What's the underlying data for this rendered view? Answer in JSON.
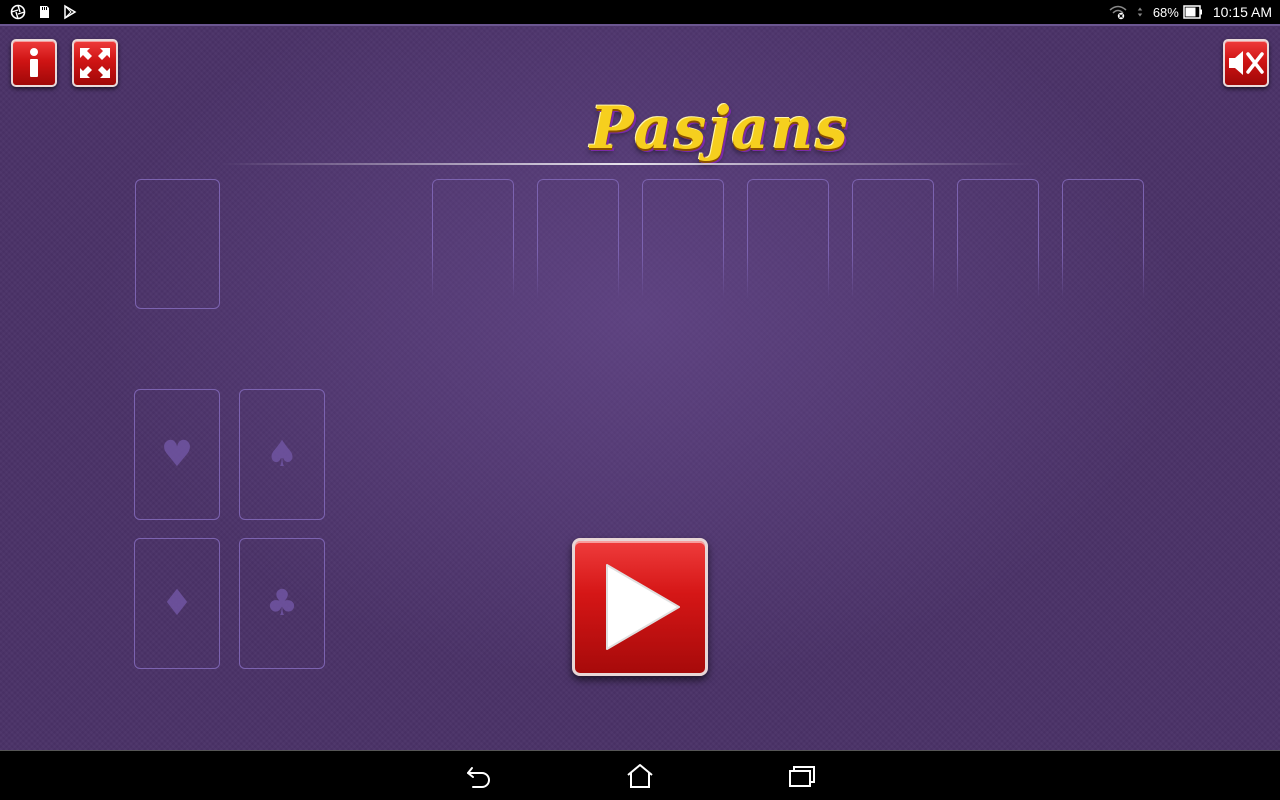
{
  "status_bar": {
    "battery": "68%",
    "time": "10:15 AM",
    "icons": [
      "aperture-icon",
      "sd-card-icon",
      "play-store-icon",
      "wifi-icon",
      "signal-icon",
      "battery-icon"
    ]
  },
  "game": {
    "title": "Pasjans",
    "colors": {
      "background": "#4a3268",
      "button_red": "#d51616",
      "title_gold": "#f6cf1e",
      "slot_border": "#7c63b0"
    },
    "buttons": {
      "info_icon": "info-icon",
      "fullscreen_icon": "fullscreen-icon",
      "mute_icon": "speaker-muted-icon",
      "play_icon": "play-icon"
    },
    "foundations": [
      {
        "suit": "♥"
      },
      {
        "suit": "♠"
      },
      {
        "suit": "♦"
      },
      {
        "suit": "♣"
      }
    ],
    "tableau_slot_count": 7
  },
  "nav_bar": {
    "icons": [
      "back-icon",
      "home-icon",
      "recent-apps-icon"
    ]
  }
}
